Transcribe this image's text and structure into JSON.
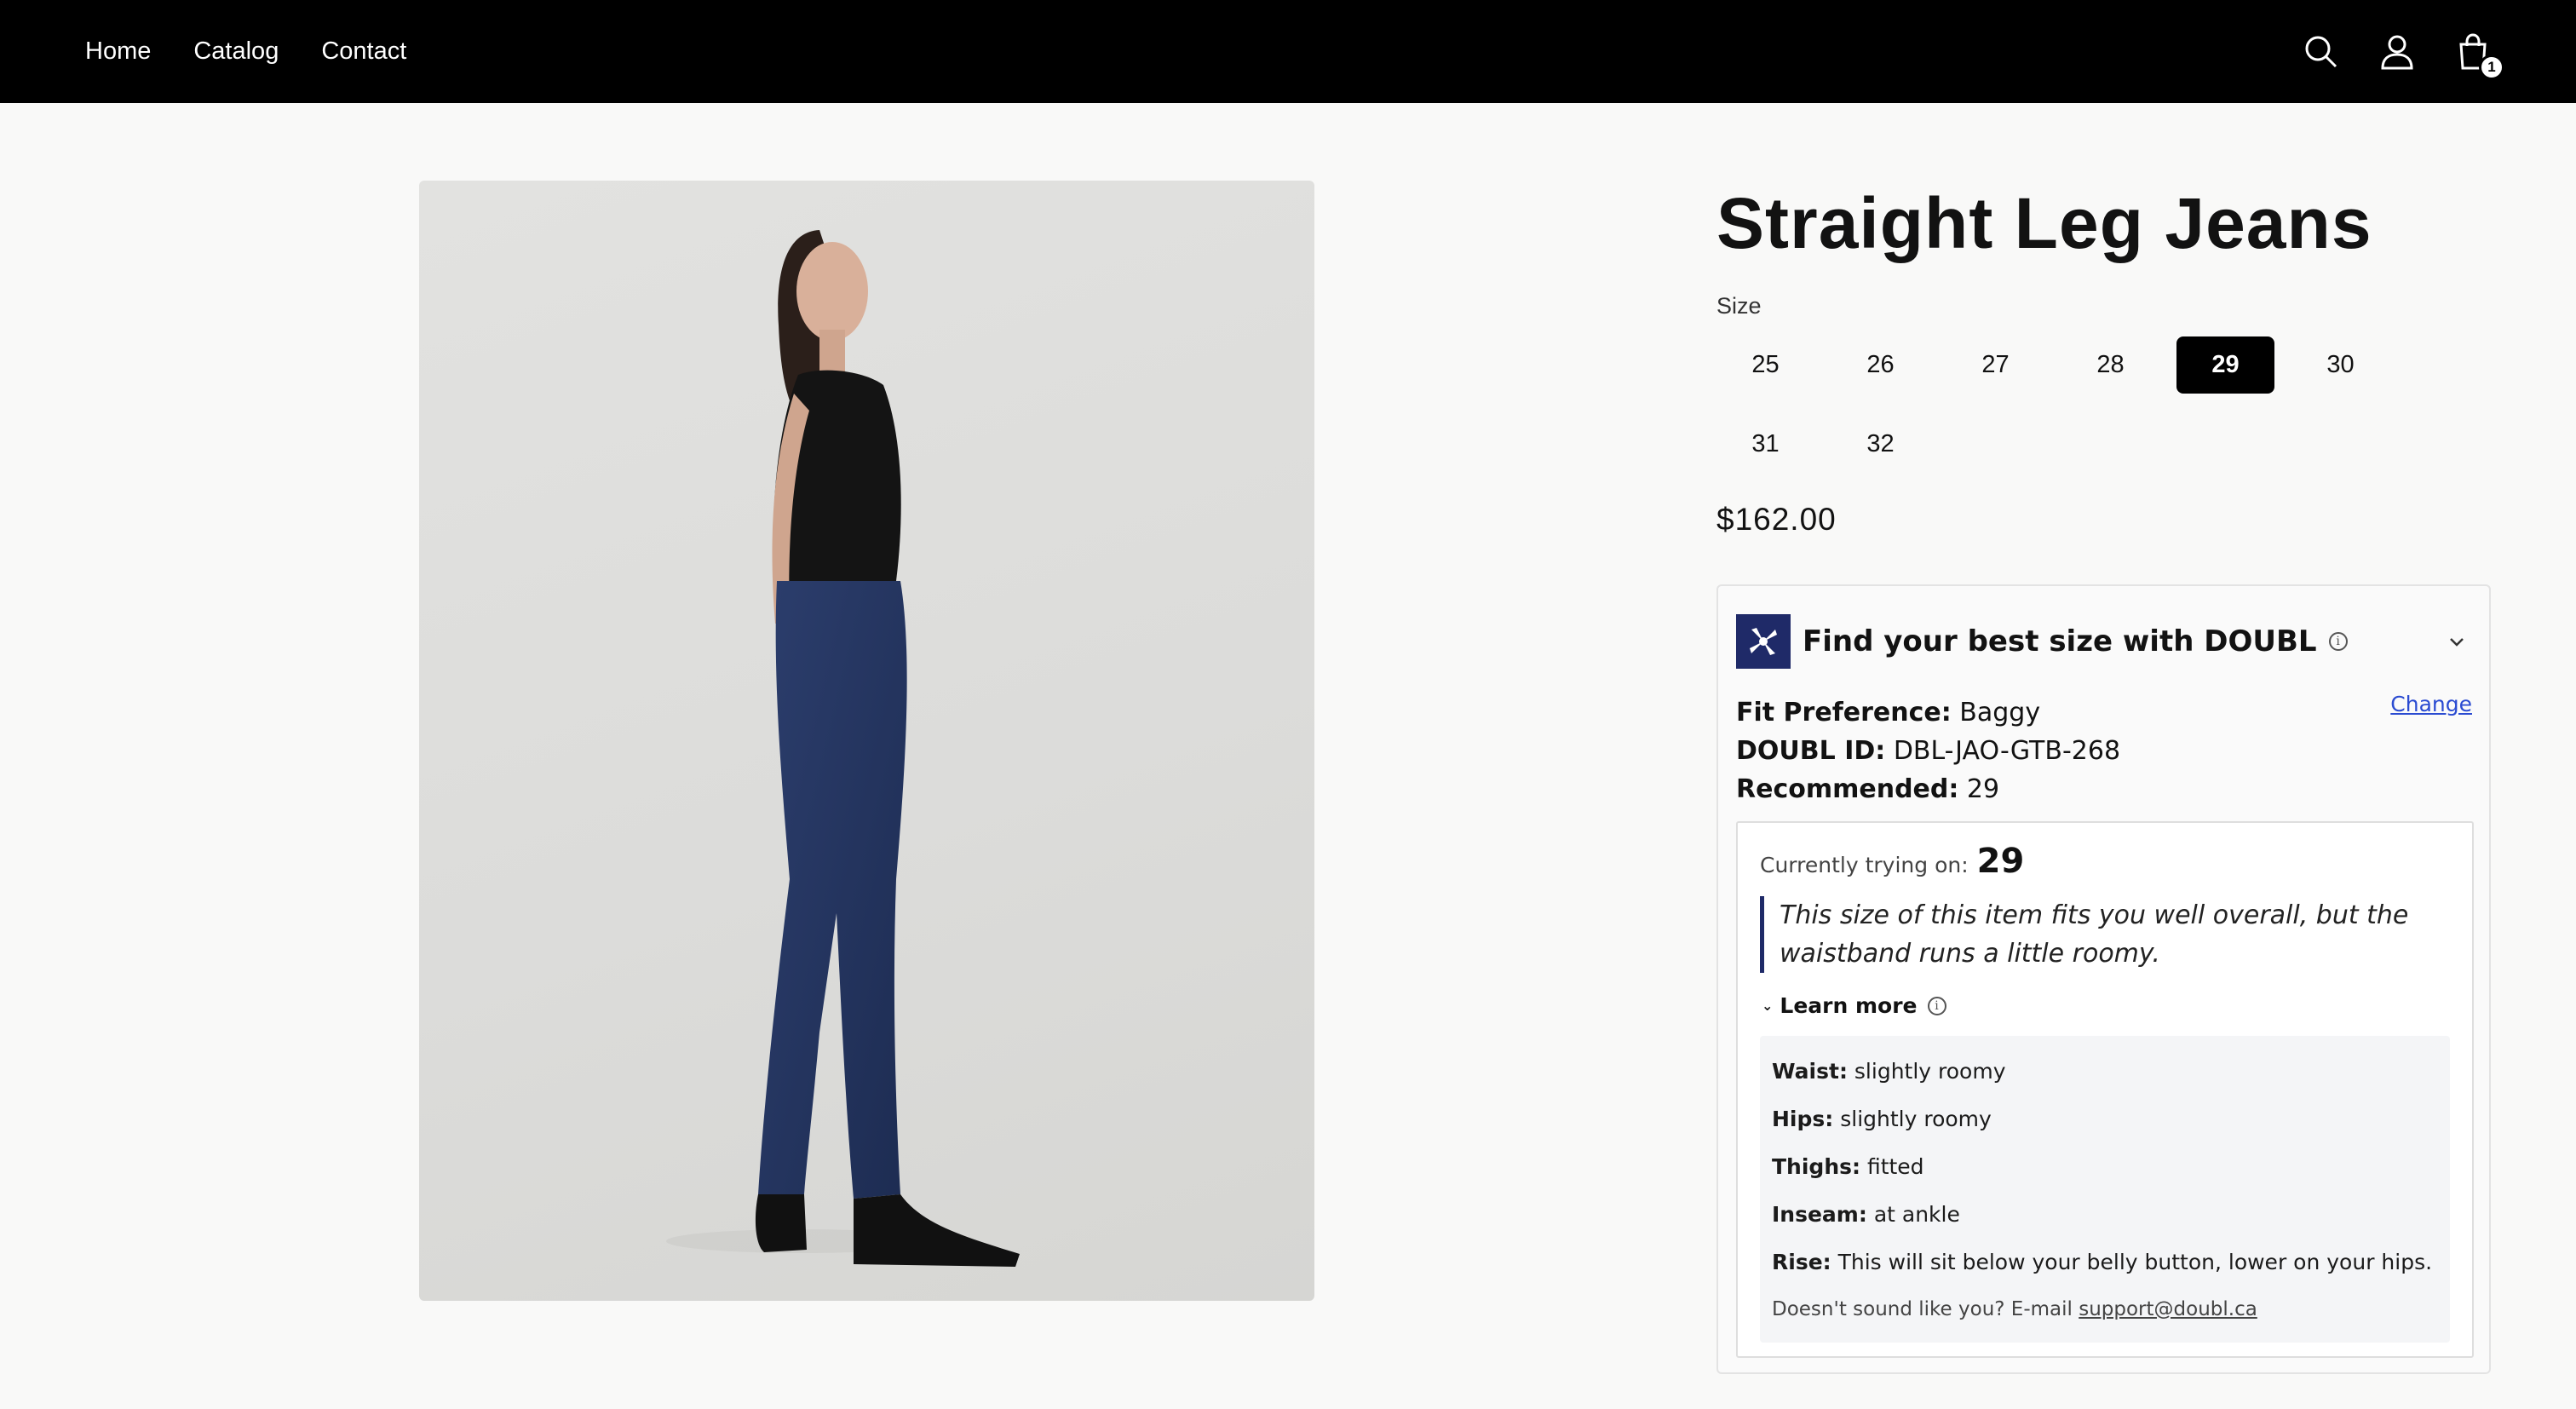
{
  "nav": {
    "links": [
      "Home",
      "Catalog",
      "Contact"
    ]
  },
  "header_icons": [
    "search-icon",
    "account-icon",
    "cart-icon"
  ],
  "cart": {
    "count": "1"
  },
  "product": {
    "title": "Straight Leg Jeans",
    "size_label": "Size",
    "sizes": [
      "25",
      "26",
      "27",
      "28",
      "29",
      "30",
      "31",
      "32"
    ],
    "selected_size": "29",
    "price": "$162.00"
  },
  "doubl": {
    "title": "Find your best size with DOUBL",
    "change_label": "Change",
    "fit_pref_label": "Fit Preference:",
    "fit_pref_value": "Baggy",
    "id_label": "DOUBL ID:",
    "id_value": "DBL-JAO-GTB-268",
    "recommended_label": "Recommended:",
    "recommended_value": "29",
    "trying_label": "Currently trying on:",
    "trying_value": "29",
    "fit_quote": "This size of this item fits you well overall, but the waistband runs a little roomy.",
    "learn_more": "Learn more",
    "fit_details": [
      {
        "label": "Waist:",
        "value": "slightly roomy"
      },
      {
        "label": "Hips:",
        "value": "slightly roomy"
      },
      {
        "label": "Thighs:",
        "value": "fitted"
      },
      {
        "label": "Inseam:",
        "value": "at ankle"
      },
      {
        "label": "Rise:",
        "value": "This will sit below your belly button, lower on your hips."
      }
    ],
    "support_text": "Doesn't sound like you? E-mail",
    "support_email": "support@doubl.ca"
  },
  "colors": {
    "header_bg": "#000000",
    "accent_navy": "#1f2a68",
    "link_blue": "#2a4bd1",
    "page_bg": "#f9f9f8"
  }
}
